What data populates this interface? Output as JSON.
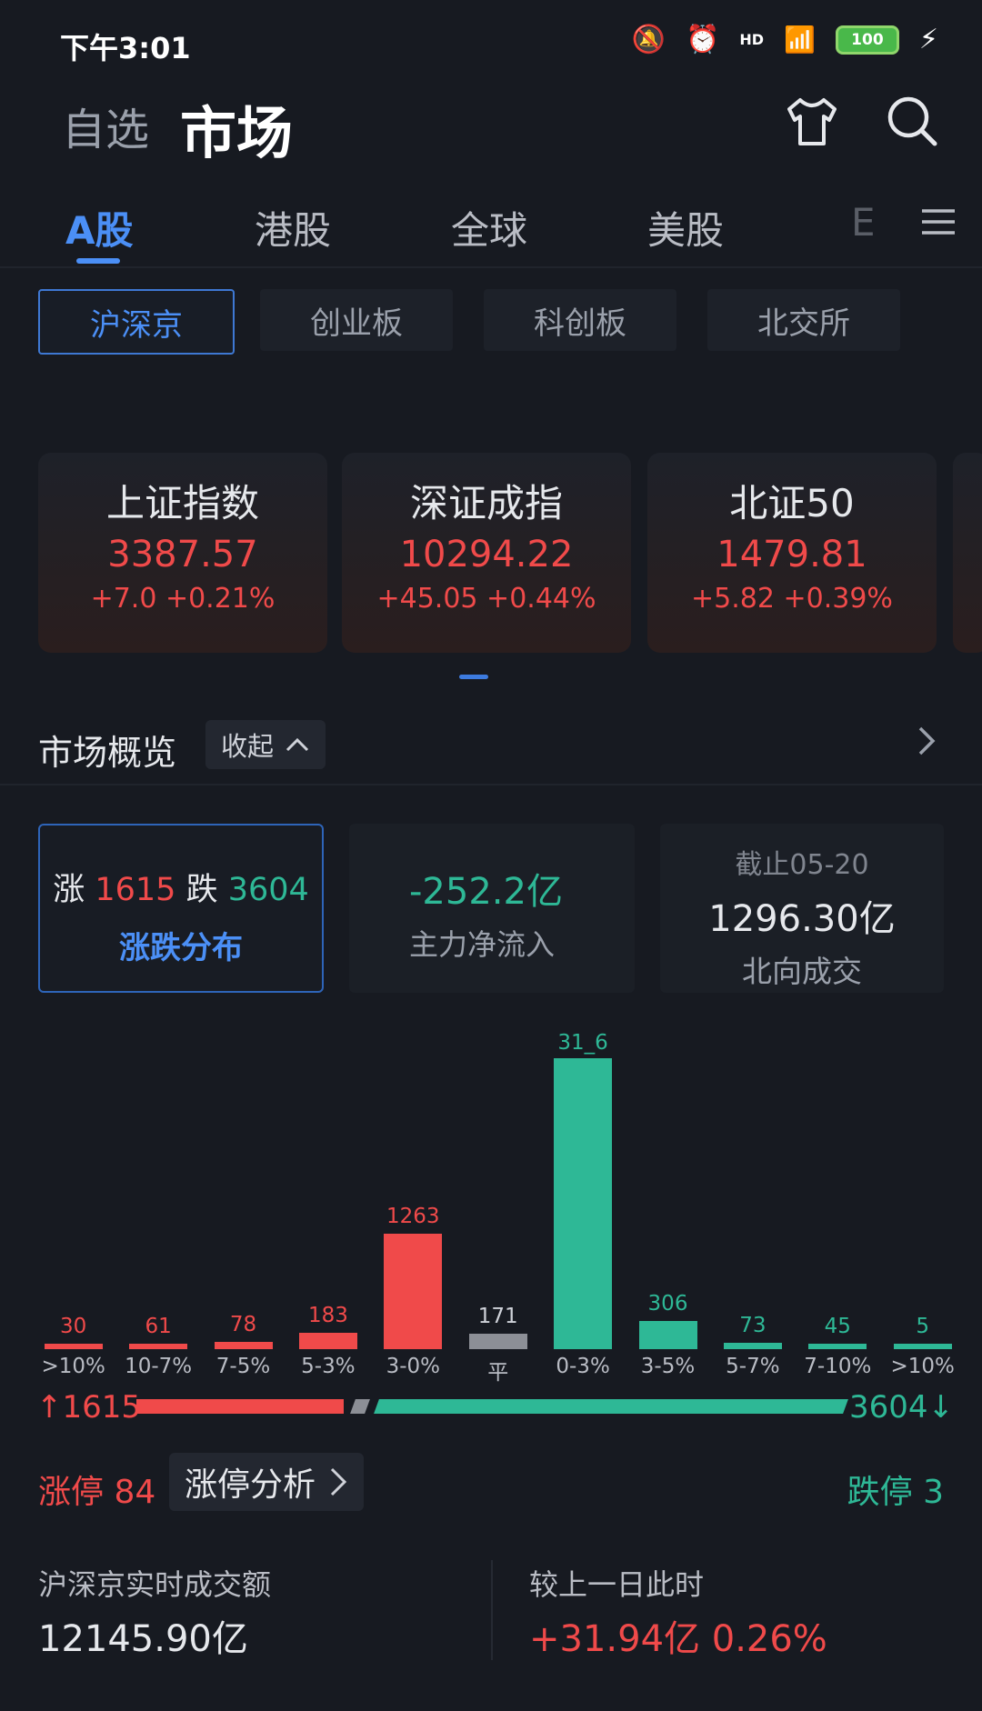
{
  "status_bar": {
    "time": "下午3:01",
    "network": "HD",
    "battery": "100"
  },
  "header": {
    "watchlist_label": "自选",
    "title": "市场"
  },
  "tabs": [
    {
      "label": "A股",
      "active": true
    },
    {
      "label": "港股"
    },
    {
      "label": "全球"
    },
    {
      "label": "美股"
    },
    {
      "label": "E"
    }
  ],
  "subtabs": [
    {
      "label": "沪深京",
      "active": true
    },
    {
      "label": "创业板"
    },
    {
      "label": "科创板"
    },
    {
      "label": "北交所"
    }
  ],
  "indices": [
    {
      "name": "上证指数",
      "value": "3387.57",
      "change": "+7.0  +0.21%"
    },
    {
      "name": "深证成指",
      "value": "10294.22",
      "change": "+45.05 +0.44%"
    },
    {
      "name": "北证50",
      "value": "1479.81",
      "change": "+5.82 +0.39%"
    }
  ],
  "overview": {
    "title": "市场概览",
    "collapse_label": "收起",
    "breadth": {
      "up_label": "涨",
      "up_value": "1615",
      "down_label": "跌",
      "down_value": "3604",
      "caption": "涨跌分布"
    },
    "main_flow": {
      "value": "-252.2亿",
      "caption": "主力净流入"
    },
    "northbound": {
      "date": "截止05-20",
      "value": "1296.30亿",
      "caption": "北向成交"
    }
  },
  "chart_data": {
    "type": "bar",
    "categories": [
      ">10%",
      "10-7%",
      "7-5%",
      "5-3%",
      "3-0%",
      "平",
      "0-3%",
      "3-5%",
      "5-7%",
      "7-10%",
      ">10%"
    ],
    "values": [
      30,
      61,
      78,
      183,
      1263,
      171,
      3176,
      306,
      73,
      45,
      5
    ],
    "value_labels": [
      "30",
      "61",
      "78",
      "183",
      "1263",
      "171",
      "31_6",
      "306",
      "73",
      "45",
      "5"
    ],
    "colors": [
      "#f04a4a",
      "#f04a4a",
      "#f04a4a",
      "#f04a4a",
      "#f04a4a",
      "#8c8f96",
      "#2eb896",
      "#2eb896",
      "#2eb896",
      "#2eb896",
      "#2eb896"
    ],
    "up_total": "↑1615",
    "down_total": "3604↓"
  },
  "limits": {
    "up": "涨停 84",
    "analysis_label": "涨停分析",
    "down": "跌停 3"
  },
  "turnover": {
    "label": "沪深京实时成交额",
    "value": "12145.90亿",
    "compare_label": "较上一日此时",
    "compare_value": "+31.94亿 0.26%"
  },
  "colors": {
    "up": "#f04a4a",
    "down": "#2eb896",
    "accent": "#4b8ff6",
    "background": "#171a21"
  }
}
